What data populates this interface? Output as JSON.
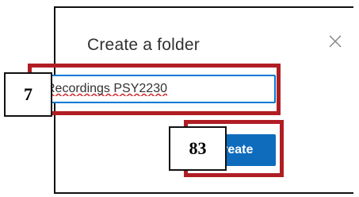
{
  "dialog": {
    "title": "Create a folder",
    "close_icon": "close-icon",
    "folder_name_value": "Recordings PSY2230",
    "create_label": "Create"
  },
  "annotations": {
    "step_input": "7",
    "step_button": "83",
    "highlight_color": "#b01e23"
  },
  "colors": {
    "accent": "#0f6cbd",
    "input_border": "#0078d4",
    "spellcheck_underline": "#d13438"
  }
}
